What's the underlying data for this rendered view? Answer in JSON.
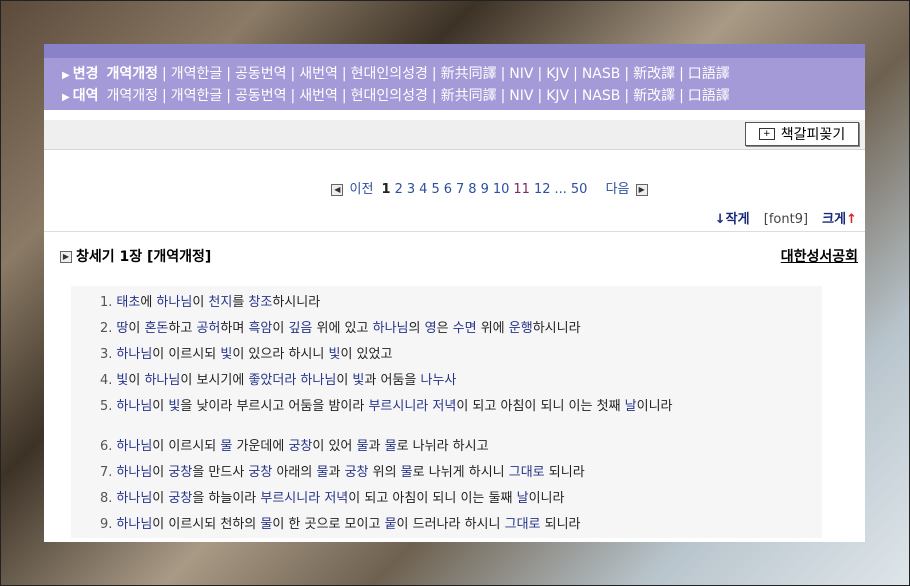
{
  "versions": {
    "change_label": "변경",
    "compare_label": "대역",
    "items": [
      "개역개정",
      "개역한글",
      "공동번역",
      "새번역",
      "현대인의성경",
      "新共同譯",
      "NIV",
      "KJV",
      "NASB",
      "新改譯",
      "口語譯"
    ]
  },
  "bookmark": {
    "label": "책갈피꽂기"
  },
  "pager": {
    "prev": "이전",
    "next": "다음",
    "pages": [
      "1",
      "2",
      "3",
      "4",
      "5",
      "6",
      "7",
      "8",
      "9",
      "10",
      "11",
      "12"
    ],
    "ellipsis": "...",
    "last": "50"
  },
  "sizes": {
    "smaller": "↓작게",
    "font": "[font9]",
    "bigger": "크게",
    "up_arrow": "↑"
  },
  "chapter": {
    "title": "창세기 1장 [개역개정]",
    "publisher": "대한성서공회"
  },
  "verses": [
    {
      "num": "1.",
      "text": "태초에 하나님이 천지를 창조하시니라"
    },
    {
      "num": "2.",
      "text": "땅이 혼돈하고 공허하며 흑암이 깊음 위에 있고 하나님의 영은 수면 위에 운행하시니라"
    },
    {
      "num": "3.",
      "text": "하나님이 이르시되 빛이 있으라 하시니 빛이 있었고"
    },
    {
      "num": "4.",
      "text": "빛이 하나님이 보시기에 좋았더라 하나님이 빛과 어둠을 나누사"
    },
    {
      "num": "5.",
      "text": "하나님이 빛을 낮이라 부르시고 어둠을 밤이라 부르시니라 저녁이 되고 아침이 되니 이는 첫째 날이니라"
    },
    {
      "num": "6.",
      "text": "하나님이 이르시되 물 가운데에 궁창이 있어 물과 물로 나뉘라 하시고"
    },
    {
      "num": "7.",
      "text": "하나님이 궁창을 만드사 궁창 아래의 물과 궁창 위의 물로 나뉘게 하시니 그대로 되니라"
    },
    {
      "num": "8.",
      "text": "하나님이 궁창을 하늘이라 부르시니라 저녁이 되고 아침이 되니 이는 둘째 날이니라"
    },
    {
      "num": "9.",
      "text": "하나님이 이르시되 천하의 물이 한 곳으로 모이고 뭍이 드러나라 하시니 그대로 되니라"
    }
  ]
}
